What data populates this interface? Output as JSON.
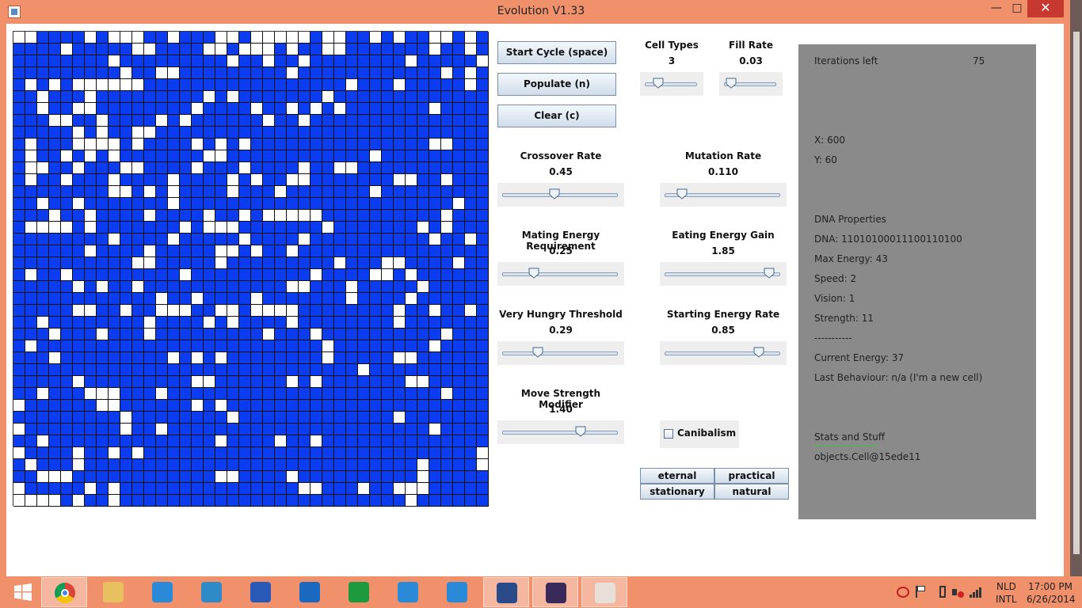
{
  "window": {
    "title": "Evolution V1.33",
    "minimize": "—",
    "maximize": "□",
    "close": "✕"
  },
  "controls": {
    "start_cycle": "Start Cycle (space)",
    "populate": "Populate (n)",
    "clear": "Clear (c)"
  },
  "params": {
    "cell_types": {
      "label": "Cell Types",
      "value": "3",
      "level": 0.2
    },
    "fill_rate": {
      "label": "Fill Rate",
      "value": "0.03",
      "level": 0.03
    },
    "crossover": {
      "label": "Crossover Rate",
      "value": "0.45",
      "level": 0.45
    },
    "mutation": {
      "label": "Mutation Rate",
      "value": "0.110",
      "level": 0.11
    },
    "mating": {
      "label": "Mating Energy Requirement",
      "value": "0.25",
      "level": 0.25
    },
    "eating": {
      "label": "Eating Energy Gain",
      "value": "1.85",
      "level": 0.95
    },
    "hungry": {
      "label": "Very Hungry Threshold",
      "value": "0.29",
      "level": 0.29
    },
    "starting": {
      "label": "Starting Energy Rate",
      "value": "0.85",
      "level": 0.85
    },
    "move_strength": {
      "label": "Move Strength Modifier",
      "value": "1.40",
      "level": 0.7
    }
  },
  "canibalism": {
    "label": "Canibalism",
    "checked": false
  },
  "modes": {
    "eternal": "eternal",
    "practical": "practical",
    "stationary": "stationary",
    "natural": "natural"
  },
  "info": {
    "iterations_label": "Iterations left",
    "iterations_value": "75",
    "x": "X: 600",
    "y": "Y: 60",
    "dna_header": "DNA Properties",
    "dna": "DNA: 11010100011100110100",
    "max_energy": "Max Energy: 43",
    "speed": "Speed: 2",
    "vision": "Vision: 1",
    "strength": "Strength: 11",
    "separator": "-----------",
    "current_energy": "Current Energy: 37",
    "last_behaviour": "Last Behaviour: n/a (I'm a new cell)",
    "stats_header": "Stats and Stuff",
    "object": "objects.Cell@15ede11"
  },
  "taskbar": {
    "items": [
      {
        "name": "start-icon",
        "color": "#ffffff"
      },
      {
        "name": "chrome-icon",
        "color": "#e0463a",
        "active": true
      },
      {
        "name": "file-explorer-icon",
        "color": "#e8c060"
      },
      {
        "name": "internet-explorer-icon",
        "color": "#2a8ad8"
      },
      {
        "name": "bs-player-icon",
        "color": "#2f8ac8"
      },
      {
        "name": "bird-app-icon",
        "color": "#2a5ab8"
      },
      {
        "name": "outlook-icon",
        "color": "#1a68c0"
      },
      {
        "name": "store-icon",
        "color": "#1e9a3e"
      },
      {
        "name": "music-icon",
        "color": "#2a8ad8"
      },
      {
        "name": "weather-icon",
        "color": "#2a8ad8"
      },
      {
        "name": "powershell-icon",
        "color": "#2a4a8a",
        "active": true
      },
      {
        "name": "java-ee-ide-icon",
        "color": "#3a2a5a",
        "active": true
      },
      {
        "name": "java-icon",
        "color": "#e8e0d8",
        "active": true
      }
    ],
    "lang_1": "NLD",
    "lang_2": "INTL",
    "time": "17:00 PM",
    "date": "6/26/2014"
  },
  "grid": {
    "size": 40,
    "cells": [
      "0011110100011011100100000100110101100101",
      "1111011111001111001000101100111111101101",
      "1111111101111111110110110111111110111110",
      "1111111110110011111111101111111111110101",
      "1010100000011111111111111111011101111101",
      "1101110111111111010111111101111111111111",
      "1101100111111110111101101010111111101111",
      "1110011011110101111110110111111111111111",
      "1111101011001111111111111111111111111111",
      "1011100001011110101011111111111111100111",
      "1011010101111111001111111111110111111111",
      "1001101110011110111011110110011111111111",
      "1011011101111011110101100111111100110111",
      "1111111100101011110111011111110111111111",
      "1101101111111011111111111111111111111011",
      "1110110111101111011010000011111111110111",
      "1000010111111101000111111101111111010111",
      "1111111101111011111011110111111111101101",
      "1111110111101111100101101111111111111111",
      "1111111111001111101111111110111001111011",
      "1011011111111101111111111011110010111111",
      "1111101011011111111111100111011111011111",
      "1111111111110110111101111111011110111111",
      "1111100110110001100100001111111101101101",
      "1101111111101111010111101111111101111111",
      "1110111011101111111110111011111111110111",
      "1011111111111111111111111101111111101111",
      "1110111111111010101111111101111100111111",
      "1111111111111111111111111111101111111111",
      "1111101111111110011111101011111110011111",
      "1101110001110111111111111111111111110111",
      "0111111001111110101111111111111111111111",
      "1111111110111111110111111111111101111111",
      "0111111110110111111111111111111111101111",
      "1101111111111111101111011011111111111111",
      "0111101101011111111111111111111111111110",
      "1011101111111111111111111111111111011110",
      "1100011111111111100111101111111111011111",
      "0111110101111111111111110011101100011111",
      "0000101101111111111111111111111110111111"
    ]
  }
}
